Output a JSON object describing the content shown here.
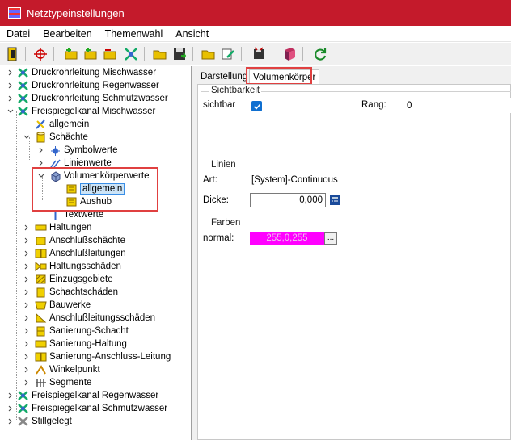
{
  "window": {
    "title": "Netztypeinstellungen"
  },
  "menu": [
    "Datei",
    "Bearbeiten",
    "Themenwahl",
    "Ansicht"
  ],
  "tree": {
    "items": [
      "Druckrohrleitung Mischwasser",
      "Druckrohrleitung Regenwasser",
      "Druckrohrleitung Schmutzwasser",
      "Freispiegelkanal Mischwasser",
      "allgemein",
      "Schächte",
      "Symbolwerte",
      "Linienwerte",
      "Volumenkörperwerte",
      "allgemein",
      "Aushub",
      "Textwerte",
      "Haltungen",
      "Anschlußschächte",
      "Anschlußleitungen",
      "Haltungsschäden",
      "Einzugsgebiete",
      "Schachtschäden",
      "Bauwerke",
      "Anschlußleitungsschäden",
      "Sanierung-Schacht",
      "Sanierung-Haltung",
      "Sanierung-Anschluss-Leitung",
      "Winkelpunkt",
      "Segmente",
      "Freispiegelkanal Regenwasser",
      "Freispiegelkanal Schmutzwasser",
      "Stillgelegt"
    ]
  },
  "tabs": {
    "darstellung": "Darstellung",
    "volumenkoerper": "Volumenkörper"
  },
  "sichtbarkeit": {
    "title": "Sichtbarkeit",
    "sichtbar_label": "sichtbar",
    "rang_label": "Rang:",
    "rang_value": "0"
  },
  "linien": {
    "title": "Linien",
    "art_label": "Art:",
    "art_value": "[System]-Continuous",
    "dicke_label": "Dicke:",
    "dicke_value": "0,000"
  },
  "farben": {
    "title": "Farben",
    "normal_label": "normal:",
    "normal_value": "255,0,255",
    "picker_label": "..."
  },
  "colors": {
    "titlebar": "#c41a2b",
    "highlight": "#e04040",
    "normal_color": "#ff00ff"
  }
}
